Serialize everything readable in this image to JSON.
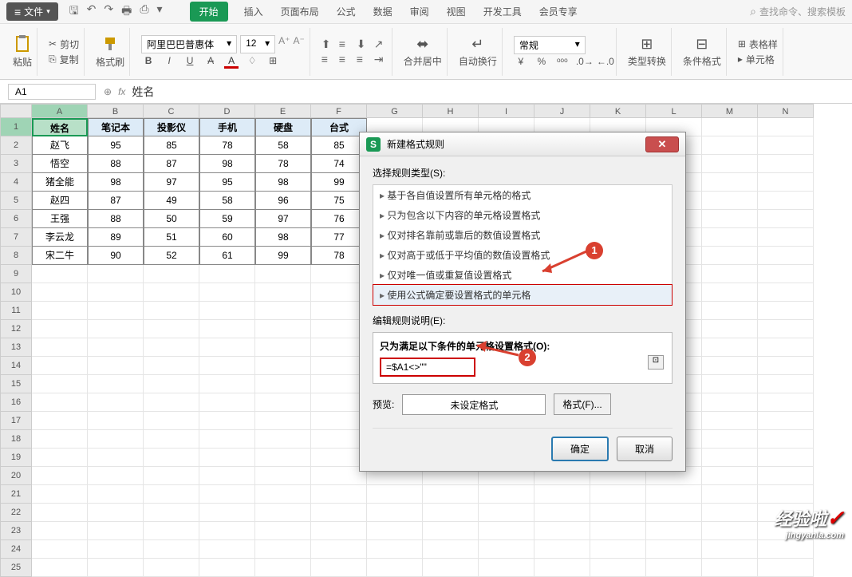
{
  "menubar": {
    "file": "文件"
  },
  "tabs": [
    "开始",
    "插入",
    "页面布局",
    "公式",
    "数据",
    "审阅",
    "视图",
    "开发工具",
    "会员专享"
  ],
  "active_tab": 0,
  "search_placeholder": "查找命令、搜索模板",
  "ribbon": {
    "paste": "粘贴",
    "cut": "剪切",
    "copy": "复制",
    "format_painter": "格式刷",
    "font_name": "阿里巴巴普惠体",
    "font_size": "12",
    "merge": "合并居中",
    "wrap": "自动换行",
    "number_format": "常规",
    "type_convert": "类型转换",
    "cond_fmt": "条件格式",
    "table_style": "表格样",
    "cell": "单元格"
  },
  "namebox": "A1",
  "fx_value": "姓名",
  "columns": [
    "A",
    "B",
    "C",
    "D",
    "E",
    "F",
    "G",
    "H",
    "I",
    "J",
    "K",
    "L",
    "M",
    "N"
  ],
  "headers": [
    "姓名",
    "笔记本",
    "投影仪",
    "手机",
    "硬盘",
    "台式"
  ],
  "table": [
    [
      "赵飞",
      "95",
      "85",
      "78",
      "58",
      "85"
    ],
    [
      "悟空",
      "88",
      "87",
      "98",
      "78",
      "74"
    ],
    [
      "猪全能",
      "98",
      "97",
      "95",
      "98",
      "99"
    ],
    [
      "赵四",
      "87",
      "49",
      "58",
      "96",
      "75"
    ],
    [
      "王强",
      "88",
      "50",
      "59",
      "97",
      "76"
    ],
    [
      "李云龙",
      "89",
      "51",
      "60",
      "98",
      "77"
    ],
    [
      "宋二牛",
      "90",
      "52",
      "61",
      "99",
      "78"
    ]
  ],
  "dialog": {
    "title": "新建格式规则",
    "select_type_label": "选择规则类型(S):",
    "rule_types": [
      "基于各自值设置所有单元格的格式",
      "只为包含以下内容的单元格设置格式",
      "仅对排名靠前或靠后的数值设置格式",
      "仅对高于或低于平均值的数值设置格式",
      "仅对唯一值或重复值设置格式",
      "使用公式确定要设置格式的单元格"
    ],
    "selected_rule": 5,
    "edit_desc_label": "编辑规则说明(E):",
    "formula_label": "只为满足以下条件的单元格设置格式(O):",
    "formula_value": "=$A1<>\"\"",
    "preview_label": "预览:",
    "preview_text": "未设定格式",
    "format_btn": "格式(F)...",
    "ok": "确定",
    "cancel": "取消"
  },
  "callouts": {
    "one": "1",
    "two": "2"
  },
  "watermark": {
    "text": "经验啦",
    "url": "jingyanla.com"
  }
}
